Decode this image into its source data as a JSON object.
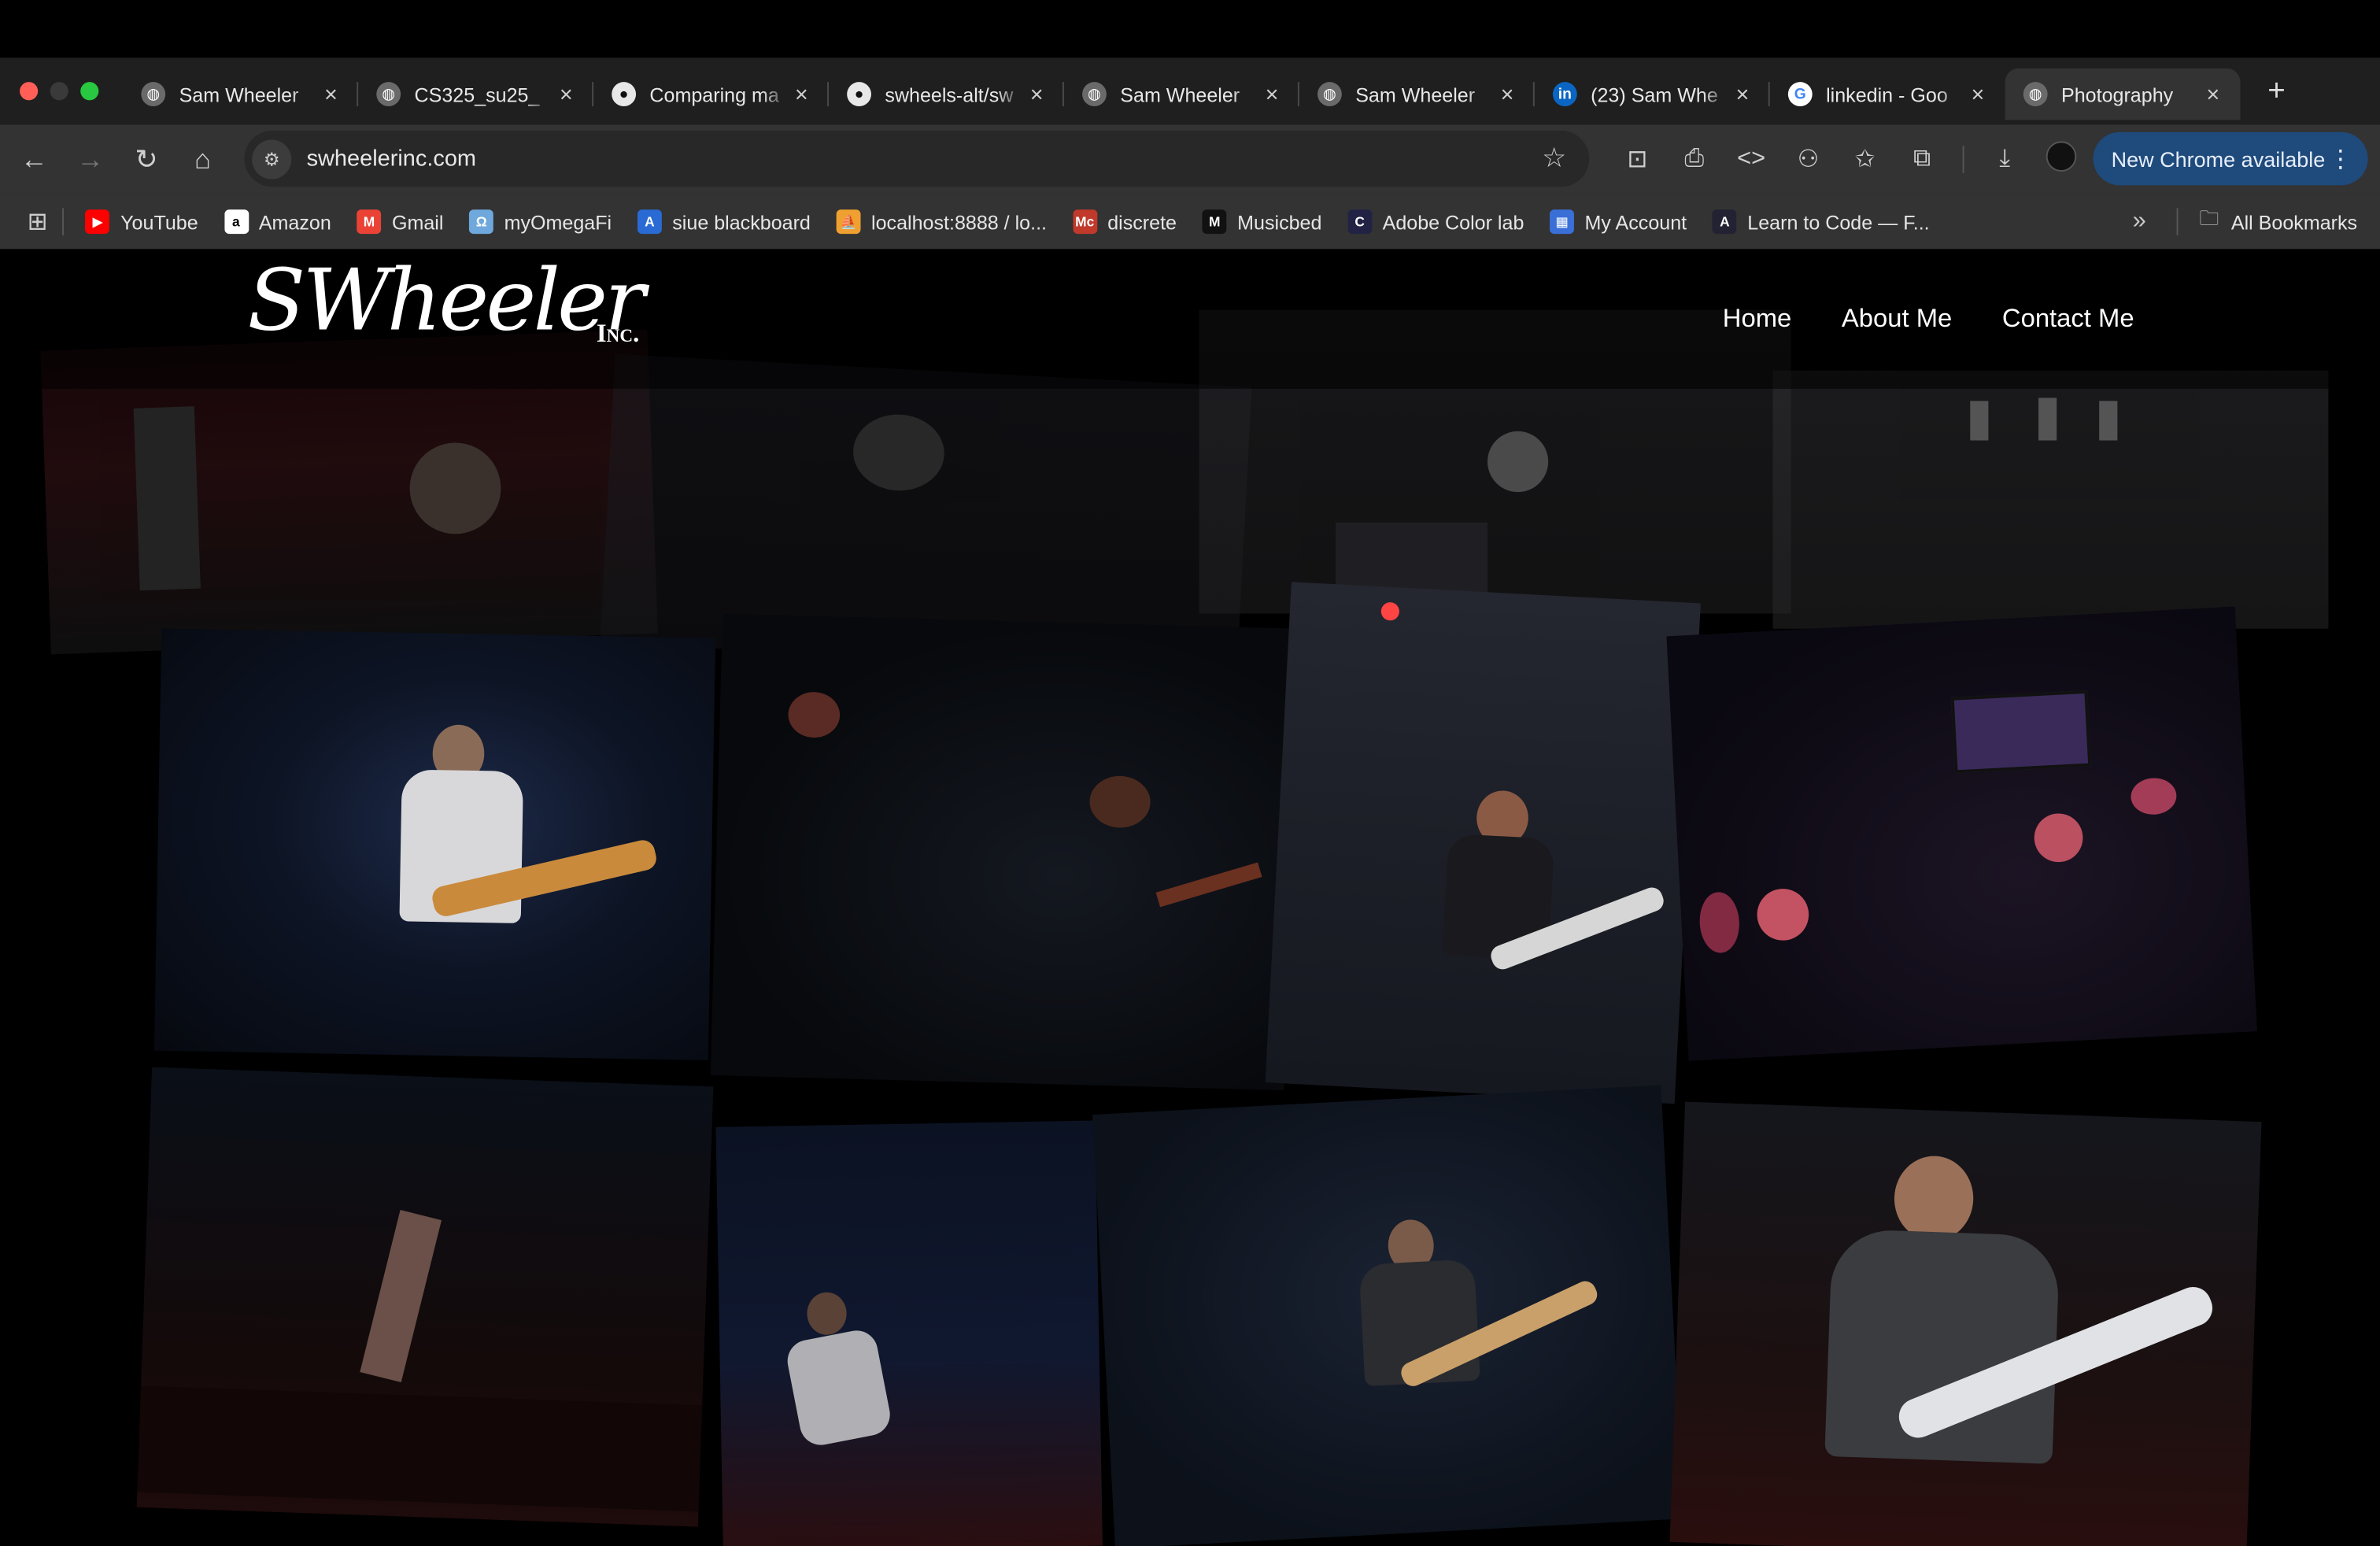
{
  "browser": {
    "tabs": [
      {
        "title": "Sam Wheeler",
        "icon": "globe-icon"
      },
      {
        "title": "CS325_su25_",
        "icon": "globe-icon"
      },
      {
        "title": "Comparing ma",
        "icon": "github-icon"
      },
      {
        "title": "swheels-alt/sw",
        "icon": "github-icon"
      },
      {
        "title": "Sam Wheeler",
        "icon": "globe-icon"
      },
      {
        "title": "Sam Wheeler",
        "icon": "globe-icon"
      },
      {
        "title": "(23) Sam Whe",
        "icon": "linkedin-icon"
      },
      {
        "title": "linkedin - Goo",
        "icon": "google-icon"
      },
      {
        "title": "Photography",
        "icon": "globe-icon",
        "active": true
      }
    ],
    "new_tab": "+",
    "close_glyph": "×",
    "url": "swheelerinc.com",
    "update_button": "New Chrome available",
    "bookmarks": [
      {
        "label": "YouTube",
        "color": "#ff0000",
        "glyph": "▶"
      },
      {
        "label": "Amazon",
        "color": "#ffffff",
        "glyph": "a"
      },
      {
        "label": "Gmail",
        "color": "#ea4335",
        "glyph": "M"
      },
      {
        "label": "myOmegaFi",
        "color": "#6ea8dc",
        "glyph": "Ω"
      },
      {
        "label": "siue blackboard",
        "color": "#2a6ad4",
        "glyph": "A"
      },
      {
        "label": "localhost:8888 / lo...",
        "color": "#f0a030",
        "glyph": "⛵"
      },
      {
        "label": "discrete",
        "color": "#c0392b",
        "glyph": "Mc"
      },
      {
        "label": "Musicbed",
        "color": "#111111",
        "glyph": "M"
      },
      {
        "label": "Adobe Color lab",
        "color": "#222244",
        "glyph": "C"
      },
      {
        "label": "My Account",
        "color": "#3b6fd8",
        "glyph": "▦"
      },
      {
        "label": "Learn to Code — F...",
        "color": "#222233",
        "glyph": "A"
      }
    ],
    "more_bookmarks": "»",
    "all_bookmarks": "All Bookmarks"
  },
  "site": {
    "logo_script": "SWheeler",
    "logo_suffix": "Inc.",
    "nav": [
      "Home",
      "About Me",
      "Contact Me"
    ]
  },
  "colors": {
    "tab_strip": "#1f1f1f",
    "toolbar": "#333333",
    "update_button": "#1f4a7c",
    "page_bg": "#000000"
  }
}
